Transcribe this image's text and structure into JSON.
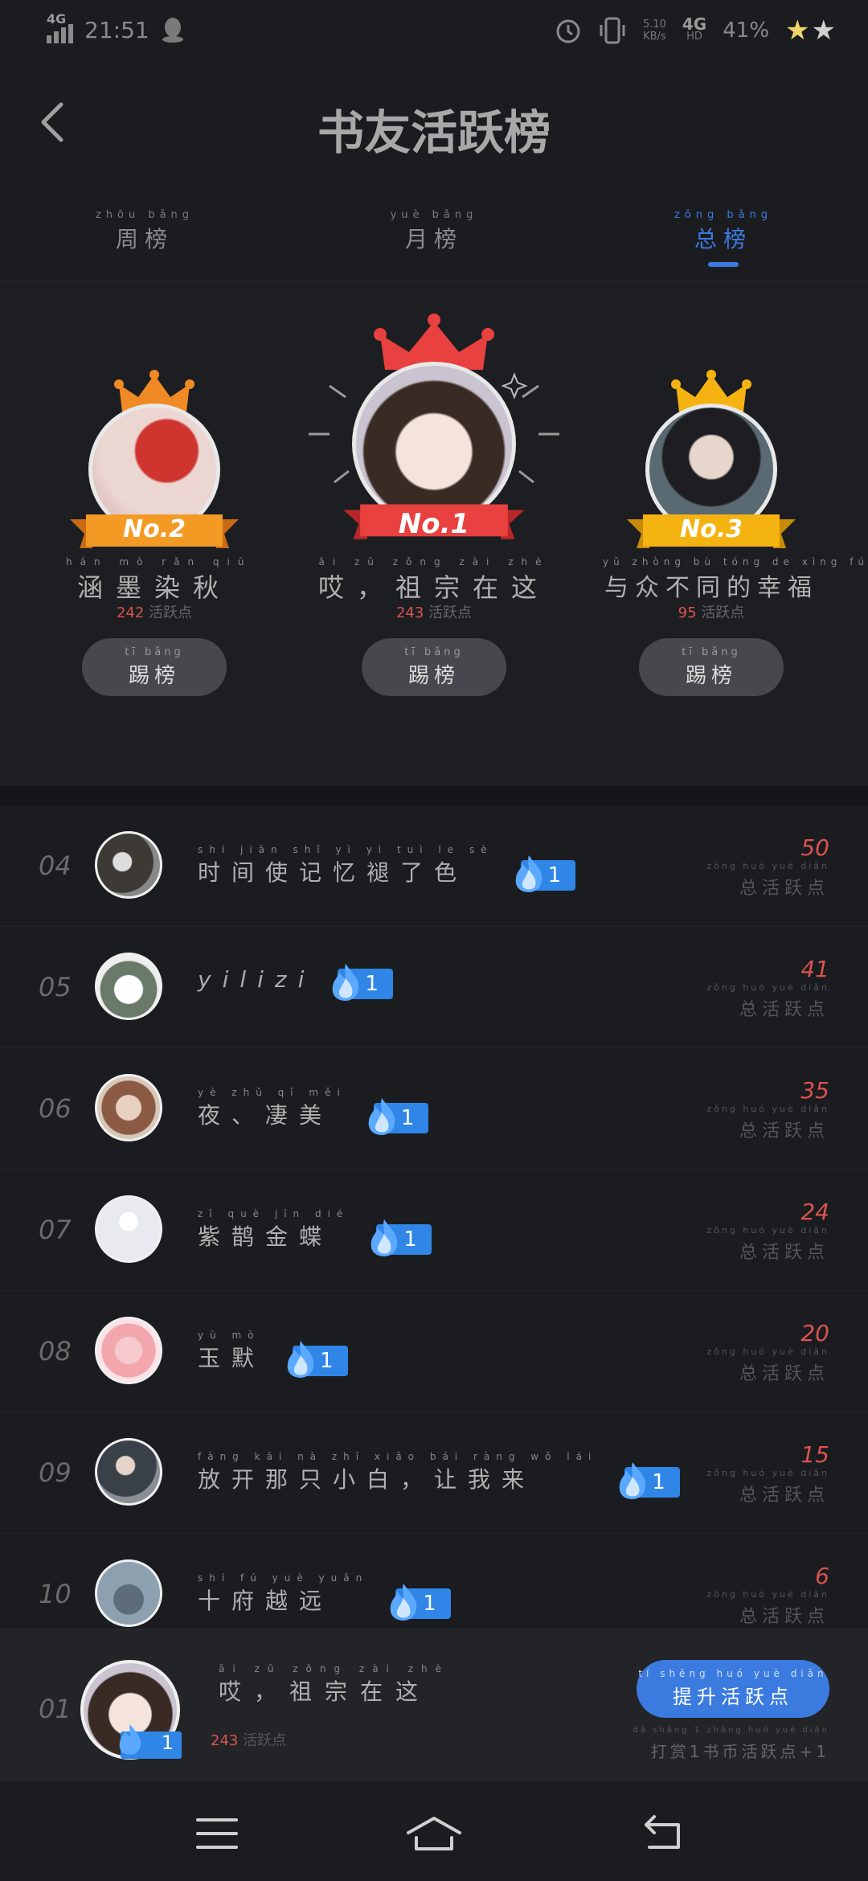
{
  "status": {
    "network": "4G",
    "time": "21:51",
    "speed_top": "5.10",
    "speed_bottom": "KB/s",
    "network2": "4G",
    "network2_sub": "HD",
    "battery": "41%",
    "stars": [
      "★",
      "★"
    ]
  },
  "header": {
    "title": "书友活跃榜"
  },
  "tabs": [
    {
      "pinyin": "zhōu bǎng",
      "label": "周榜"
    },
    {
      "pinyin": "yuè bǎng",
      "label": "月榜"
    },
    {
      "pinyin": "zǒng bǎng",
      "label": "总榜"
    }
  ],
  "podium": {
    "first": {
      "badge": "No.1",
      "name_pinyin": "āi   zǔ zǒng zài zhè",
      "name": "哎，祖宗在这",
      "score": "243",
      "score_label": "活跃点",
      "button_pinyin": "tī bǎng",
      "button": "踢榜"
    },
    "second": {
      "badge": "No.2",
      "name_pinyin": "hán mò rǎn qiū",
      "name": "涵墨染秋",
      "score": "242",
      "score_label": "活跃点",
      "button_pinyin": "tī bǎng",
      "button": "踢榜"
    },
    "third": {
      "badge": "No.3",
      "name_pinyin": "yǔ zhòng bù tóng de xìng fú",
      "name": "与众不同的幸福",
      "score": "95",
      "score_label": "活跃点",
      "button_pinyin": "tī bǎng",
      "button": "踢榜"
    }
  },
  "list_score_pinyin": "zǒng huó yuè diǎn",
  "list_score_label": "总活跃点",
  "list": [
    {
      "rank": "04",
      "pinyin": "shí jiān shǐ yì yì tuì le sè",
      "name": "时间使记忆褪了色",
      "plain": false,
      "fire": "1",
      "score": "50"
    },
    {
      "rank": "05",
      "pinyin": "",
      "name": "yilizi",
      "plain": true,
      "fire": "1",
      "score": "41"
    },
    {
      "rank": "06",
      "pinyin": "yè  zhǔ qī měi",
      "name": "夜、凄美",
      "plain": false,
      "fire": "1",
      "score": "35"
    },
    {
      "rank": "07",
      "pinyin": "zǐ què jīn dié",
      "name": "紫鹊金蝶",
      "plain": false,
      "fire": "1",
      "score": "24"
    },
    {
      "rank": "08",
      "pinyin": "yù mò",
      "name": "玉默",
      "plain": false,
      "fire": "1",
      "score": "20"
    },
    {
      "rank": "09",
      "pinyin": "fàng kāi nà zhī xiǎo bái   ràng wǒ lái",
      "name": "放开那只小白，让我来",
      "plain": false,
      "fire": "1",
      "score": "15"
    },
    {
      "rank": "10",
      "pinyin": "shí fú yuè yuǎn",
      "name": "十府越远",
      "plain": false,
      "fire": "1",
      "score": "6"
    }
  ],
  "me": {
    "rank": "01",
    "badge": "1",
    "name_pinyin": "āi   zǔ zǒng zài zhè",
    "name": "哎，祖宗在这",
    "score": "243",
    "score_label": "活跃点",
    "boost_pinyin": "tí shēng huó yuè diǎn",
    "boost": "提升活跃点",
    "hint_pinyin": "dǎ shǎng 1 zhāng huó yuè diǎn",
    "hint": "打赏1书币活跃点+1"
  },
  "colors": {
    "accent": "#3b7be0",
    "score": "#d9534f",
    "fire": "#2f86e6",
    "background": "#1b1c20"
  },
  "icons": [
    "back-arrow-icon",
    "menu-icon",
    "home-icon",
    "return-icon",
    "alarm-icon",
    "vibrate-icon",
    "flame-icon",
    "crown-icon"
  ]
}
